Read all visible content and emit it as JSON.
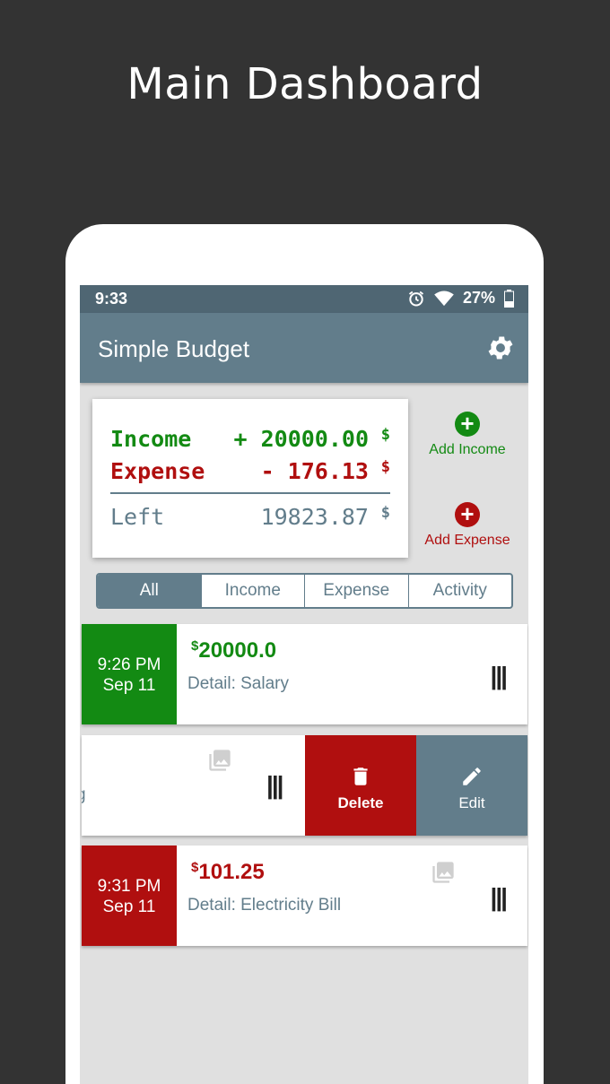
{
  "headline": "Main Dashboard",
  "status_bar": {
    "time": "9:33",
    "battery": "27%",
    "icons": [
      "alarm-icon",
      "wifi-icon",
      "battery-icon"
    ]
  },
  "app_bar": {
    "title": "Simple Budget",
    "settings_icon": "gear-icon"
  },
  "summary": {
    "income_label": "Income",
    "income_value": "+ 20000.00",
    "expense_label": "Expense",
    "expense_value": "- 176.13",
    "left_label": "Left",
    "left_value": "19823.87",
    "currency": "$"
  },
  "actions": {
    "add_income": "Add Income",
    "add_expense": "Add Expense"
  },
  "tabs": [
    {
      "label": "All",
      "active": true
    },
    {
      "label": "Income",
      "active": false
    },
    {
      "label": "Expense",
      "active": false
    },
    {
      "label": "Activity",
      "active": false
    }
  ],
  "transactions": [
    {
      "time": "9:26 PM",
      "date": "Sep 11",
      "currency": "$",
      "amount": "20000.0",
      "detail": "Detail: Salary",
      "type": "income"
    },
    {
      "partial_text": "g",
      "type": "swiped"
    },
    {
      "time": "9:31 PM",
      "date": "Sep 11",
      "currency": "$",
      "amount": "101.25",
      "detail": "Detail: Electricity Bill",
      "type": "expense"
    }
  ],
  "swipe_actions": {
    "delete": "Delete",
    "edit": "Edit"
  },
  "colors": {
    "income": "#138a13",
    "expense": "#b00f0f",
    "primary": "#627d8b",
    "status_bar": "#4f6673"
  }
}
